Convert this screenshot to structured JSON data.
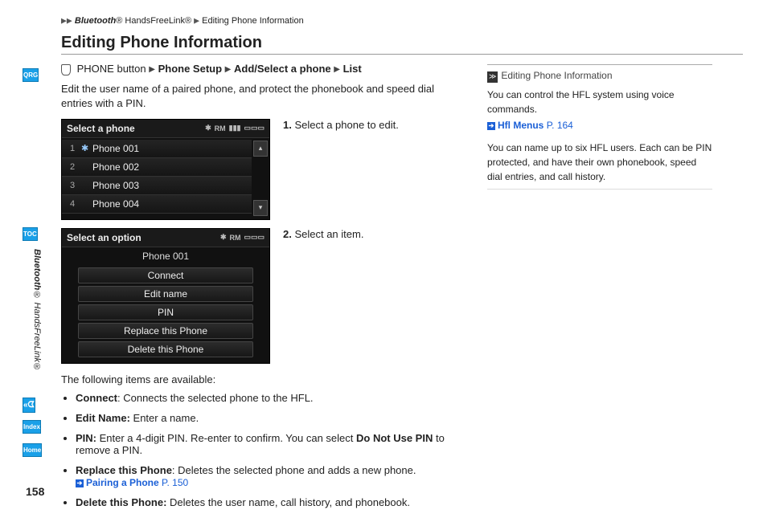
{
  "page_number": "158",
  "side_tabs": {
    "qrg": "QRG",
    "toc": "TOC",
    "voice": "",
    "index": "Index",
    "home": "Home"
  },
  "vertical_section": {
    "bt": "Bluetooth",
    "reg1": "®",
    "hfl": " HandsFreeLink",
    "reg2": "®"
  },
  "breadcrumb": {
    "bt": "Bluetooth",
    "reg1": "®",
    "hfl": " HandsFreeLink",
    "reg2": "®",
    "tail": "Editing Phone Information"
  },
  "title": "Editing Phone Information",
  "nav_path": {
    "phone_btn": "PHONE button",
    "seg1": "Phone Setup",
    "seg2": "Add/Select a phone",
    "seg3": "List"
  },
  "intro": "Edit the user name of a paired phone, and protect the phonebook and speed dial entries with a PIN.",
  "screen1": {
    "title": "Select a phone",
    "status_bt": "✱",
    "status_txt": "RM",
    "status_sig": "▮▮▮",
    "status_batt": "▭▭▭",
    "rows": [
      {
        "idx": "1",
        "bt": "✱",
        "name": "Phone 001"
      },
      {
        "idx": "2",
        "bt": "",
        "name": "Phone 002"
      },
      {
        "idx": "3",
        "bt": "",
        "name": "Phone 003"
      },
      {
        "idx": "4",
        "bt": "",
        "name": "Phone 004"
      }
    ]
  },
  "step1_num": "1.",
  "step1_txt": " Select a phone to edit.",
  "screen2": {
    "title": "Select an option",
    "status_bt": "✱",
    "status_txt": "RM",
    "status_batt": "▭▭▭",
    "selected": "Phone 001",
    "options": [
      "Connect",
      "Edit name",
      "PIN",
      "Replace this Phone",
      "Delete this Phone"
    ]
  },
  "step2_num": "2.",
  "step2_txt": " Select an item.",
  "after": "The following items are available:",
  "items": {
    "connect": {
      "label": "Connect",
      "text": ": Connects the selected phone to the HFL."
    },
    "edit": {
      "label": "Edit Name:",
      "text": " Enter a name."
    },
    "pin": {
      "label": "PIN:",
      "text": " Enter a 4-digit PIN. Re-enter to confirm. You can select ",
      "bold2": "Do Not Use PIN",
      "text2": " to remove a PIN."
    },
    "replace": {
      "label": "Replace this Phone",
      "text": ": Deletes the selected phone and adds a new phone."
    },
    "replace_xref": {
      "label": "Pairing a Phone",
      "page": "P. 150"
    },
    "delete": {
      "label": "Delete this Phone:",
      "text": " Deletes the user name, call history, and phonebook."
    }
  },
  "sidebar_note": {
    "head": "Editing Phone Information",
    "p1": "You can control the HFL system using voice commands.",
    "xref": {
      "label": "Hfl Menus",
      "page": "P. 164"
    },
    "p2": "You can name up to six HFL users. Each can be PIN protected, and have their own phonebook, speed dial entries, and call history."
  }
}
